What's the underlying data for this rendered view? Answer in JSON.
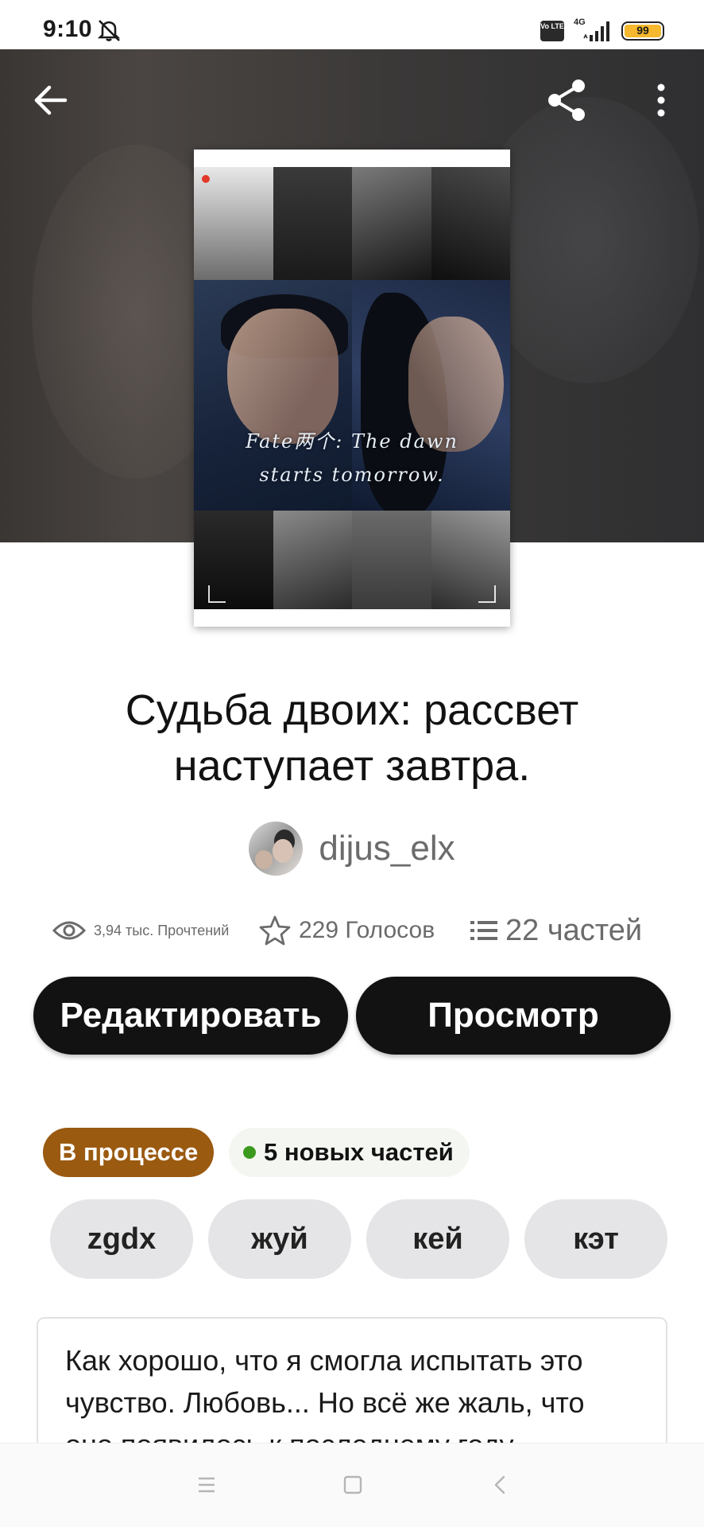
{
  "status_bar": {
    "time": "9:10",
    "volte": "Vo LTE",
    "network": "4G",
    "battery": "99",
    "icons": [
      "bell-off-icon",
      "signal-icon",
      "battery-icon"
    ]
  },
  "toolbar": {
    "back_icon": "arrow-left-icon",
    "share_icon": "share-icon",
    "more_icon": "more-vertical-icon"
  },
  "cover": {
    "title_line1": "Fate两个: The dawn",
    "title_line2": "starts tomorrow."
  },
  "book": {
    "title": "Судьба двоих: рассвет наступает завтра.",
    "author": "dijus_elx"
  },
  "stats": {
    "reads": "3,94 тыс. Прочтений",
    "votes": "229 Голосов",
    "parts": "22 частей"
  },
  "actions": {
    "edit_label": "Редактировать",
    "view_label": "Просмотр"
  },
  "status": {
    "progress_label": "В процессе",
    "new_parts_label": "5 новых частей",
    "colors": {
      "progress": "#9a5a10",
      "new_dot": "#3b9a1e"
    }
  },
  "tags": [
    "zgdx",
    "жуй",
    "кей",
    "кэт"
  ],
  "description": "Как хорошо, что я смогла испытать это чувство. Любовь... Но всё же жаль, что оно появилось к последнему году",
  "nav_bar": {
    "icons": [
      "menu-icon",
      "home-square-icon",
      "back-chevron-icon"
    ]
  }
}
